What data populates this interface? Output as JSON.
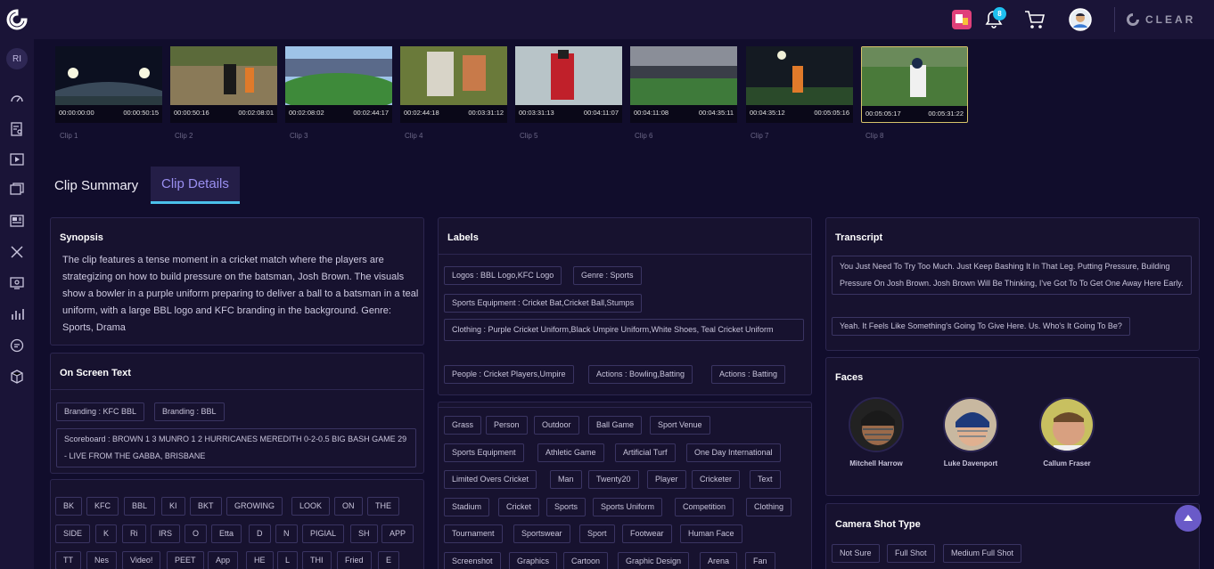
{
  "topbar": {
    "notification_count": "8",
    "brand": "CLEAR",
    "icons": [
      "app-logo-icon",
      "studio-app-icon",
      "bell-icon",
      "cart-icon",
      "user-avatar-icon"
    ]
  },
  "sidebar": {
    "user_initials": "RI",
    "icons": [
      "dashboard-icon",
      "search-list-icon",
      "video-icon",
      "folders-icon",
      "news-icon",
      "tools-icon",
      "review-icon",
      "analytics-icon",
      "chat-icon",
      "package-icon"
    ]
  },
  "clips": [
    {
      "label": "Clip 1",
      "start": "00:00:00:00",
      "end": "00:00:50:15"
    },
    {
      "label": "Clip 2",
      "start": "00:00:50:16",
      "end": "00:02:08:01"
    },
    {
      "label": "Clip 3",
      "start": "00:02:08:02",
      "end": "00:02:44:17"
    },
    {
      "label": "Clip 4",
      "start": "00:02:44:18",
      "end": "00:03:31:12"
    },
    {
      "label": "Clip 5",
      "start": "00:03:31:13",
      "end": "00:04:11:07"
    },
    {
      "label": "Clip 6",
      "start": "00:04:11:08",
      "end": "00:04:35:11"
    },
    {
      "label": "Clip 7",
      "start": "00:04:35:12",
      "end": "00:05:05:16"
    },
    {
      "label": "Clip 8",
      "start": "00:05:05:17",
      "end": "00:05:31:22"
    }
  ],
  "tabs": {
    "summary": "Clip Summary",
    "details": "Clip Details"
  },
  "synopsis": {
    "title": "Synopsis",
    "text": "The clip features a tense moment in a cricket match where the players are strategizing on how to build pressure on the batsman, Josh Brown. The visuals show a bowler in a purple uniform preparing to deliver a ball to a batsman in a teal uniform, with a large BBL logo and KFC branding in the background. Genre: Sports, Drama"
  },
  "on_screen_text": {
    "title": "On Screen Text",
    "branding": [
      "Branding : KFC BBL",
      "Branding : BBL"
    ],
    "scoreboard": "Scoreboard : BROWN 1 3 MUNRO 1 2 HURRICANES MEREDITH 0-2-0.5 BIG BASH GAME 29 - LIVE FROM THE GABBA, BRISBANE",
    "words_row1": [
      "BK",
      "KFC",
      "BBL",
      "KI",
      "BKT",
      "GROWING",
      "LOOK",
      "ON",
      "THE"
    ],
    "words_row2": [
      "SIDE",
      "K",
      "Ri",
      "IRS",
      "O",
      "Etta",
      "D",
      "N",
      "PIGIAL",
      "SH",
      "APP"
    ],
    "words_row3": [
      "TT",
      "Nes",
      "Video!",
      "PEET",
      "App",
      "HE",
      "L",
      "THI",
      "Fried",
      "E"
    ]
  },
  "labels": {
    "title": "Labels",
    "structured": [
      "Logos : BBL Logo,KFC Logo",
      "Genre : Sports",
      "Sports Equipment : Cricket Bat,Cricket Ball,Stumps",
      "Clothing : Purple Cricket Uniform,Black Umpire Uniform,White Shoes, Teal Cricket Uniform",
      "People : Cricket Players,Umpire",
      "Actions : Bowling,Batting",
      "Actions : Batting"
    ],
    "row1": [
      "Grass",
      "Person",
      "Outdoor",
      "Ball Game",
      "Sport Venue"
    ],
    "row2": [
      "Sports Equipment",
      "Athletic Game",
      "Artificial Turf",
      "One Day International"
    ],
    "row3": [
      "Limited Overs Cricket",
      "Man",
      "Twenty20",
      "Player",
      "Cricketer",
      "Text"
    ],
    "row4": [
      "Stadium",
      "Cricket",
      "Sports",
      "Sports Uniform",
      "Competition",
      "Clothing"
    ],
    "row5": [
      "Tournament",
      "Sportswear",
      "Sport",
      "Footwear",
      "Human Face"
    ],
    "row6": [
      "Screenshot",
      "Graphics",
      "Cartoon",
      "Graphic Design",
      "Arena",
      "Fan"
    ]
  },
  "transcript": {
    "title": "Transcript",
    "lines": [
      "You Just Need To Try Too Much. Just Keep Bashing It In That Leg. Putting Pressure, Building Pressure On Josh Brown. Josh Brown Will Be Thinking, I've Got To To Get One Away Here Early.",
      "Yeah. It Feels Like Something's Going To Give Here. Us. Who's It Going To Be?"
    ]
  },
  "faces": {
    "title": "Faces",
    "people": [
      "Mitchell Harrow",
      "Luke Davenport",
      "Callum Fraser"
    ]
  },
  "camera_shot": {
    "title": "Camera Shot Type",
    "types": [
      "Not Sure",
      "Full Shot",
      "Medium Full Shot"
    ]
  },
  "colors": {
    "background": "#110d2c",
    "panel": "#17122f",
    "accent": "#4bc0ea",
    "tab_active_text": "#9a8ff0",
    "selected_clip_border": "#d8c46a",
    "scroll_button": "#6a5ac8"
  }
}
